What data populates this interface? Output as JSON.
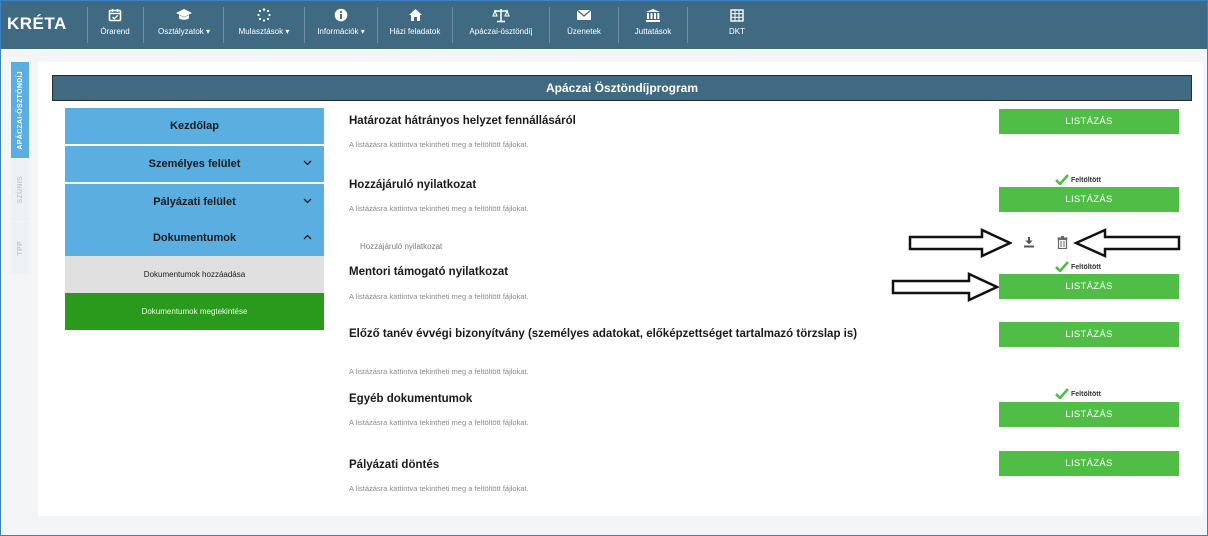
{
  "app": {
    "logo": "KRÉTA"
  },
  "nav": {
    "items": [
      {
        "label": "Órarend",
        "icon": "calendar-icon"
      },
      {
        "label": "Osztályzatok ▾",
        "icon": "graduation-cap-icon"
      },
      {
        "label": "Mulasztások ▾",
        "icon": "spinner-icon"
      },
      {
        "label": "Információk ▾",
        "icon": "info-icon"
      },
      {
        "label": "Házi feladatok",
        "icon": "home-icon"
      },
      {
        "label": "Apáczai-ösztöndíj",
        "icon": "scale-icon"
      },
      {
        "label": "Üzenetek",
        "icon": "envelope-icon"
      },
      {
        "label": "Juttatások",
        "icon": "bank-icon"
      },
      {
        "label": "DKT",
        "icon": "grid-icon"
      }
    ]
  },
  "side_tabs": [
    {
      "label": "APÁCZAI-ÖSZTÖNDÍJ",
      "active": true
    },
    {
      "label": "SZÜNIS",
      "active": false
    },
    {
      "label": "TPP",
      "active": false
    }
  ],
  "page": {
    "title": "Apáczai Ösztöndíjprogram"
  },
  "menu": {
    "items": [
      {
        "label": "Kezdőlap",
        "chevron": ""
      },
      {
        "label": "Személyes felület",
        "chevron": "⌄"
      },
      {
        "label": "Pályázati felület",
        "chevron": "⌄"
      },
      {
        "label": "Dokumentumok",
        "chevron": "⌃"
      }
    ],
    "sub_items": [
      {
        "label": "Dokumentumok hozzáadása"
      },
      {
        "label": "Dokumentumok megtekintése"
      }
    ]
  },
  "documents": [
    {
      "title": "Határozat hátrányos helyzet fennállásáról",
      "hint": "A listázásra kattintva tekintheti meg a feltöltött fájlokat.",
      "button": "LISTÁZÁS",
      "status": ""
    },
    {
      "title": "Hozzájáruló nyilatkozat",
      "hint": "A listázásra kattintva tekintheti meg a feltöltött fájlokat.",
      "button": "LISTÁZÁS",
      "status": "Feltöltött"
    },
    {
      "title": "Mentori támogató nyilatkozat",
      "hint": "A listázásra kattintva tekintheti meg a feltöltött fájlokat.",
      "button": "LISTÁZÁS",
      "status": "Feltöltött"
    },
    {
      "title": "Előző tanév évvégi bizonyítvány (személyes adatokat, előképzettséget tartalmazó törzslap is)",
      "hint": "A listázásra kattintva tekintheti meg a feltöltött fájlokat.",
      "button": "LISTÁZÁS",
      "status": ""
    },
    {
      "title": "Egyéb dokumentumok",
      "hint": "A listázásra kattintva tekintheti meg a feltöltött fájlokat.",
      "button": "LISTÁZÁS",
      "status": "Feltöltött"
    },
    {
      "title": "Pályázati döntés",
      "hint": "A listázásra kattintva tekintheti meg a feltöltött fájlokat.",
      "button": "LISTÁZÁS",
      "status": ""
    }
  ],
  "uploaded_file": {
    "name": "Hozzájáruló nyilatkozat",
    "download_icon": "download-icon",
    "delete_icon": "trash-icon"
  },
  "colors": {
    "nav_bg": "#3f6a82",
    "menu_blue": "#5aaee0",
    "active_green": "#2a9a1c",
    "button_green": "#4fbd46",
    "submenu_grey": "#e0e0e0"
  }
}
